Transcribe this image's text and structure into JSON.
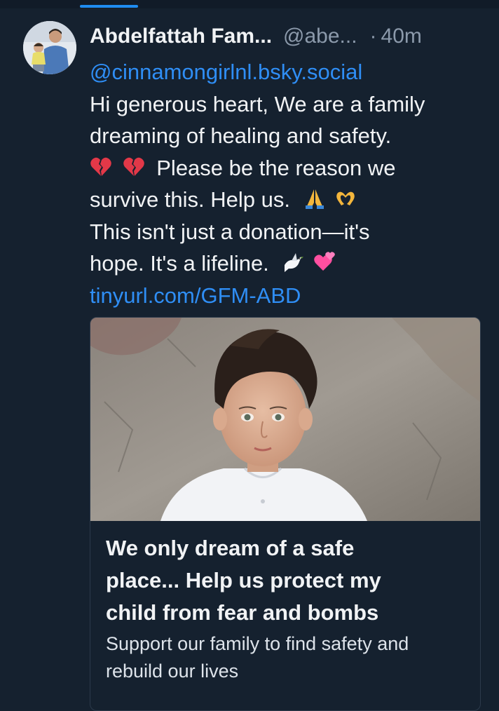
{
  "post": {
    "author_name": "Abdelfattah Fam...",
    "author_handle": "@abe...",
    "separator": "·",
    "timestamp": "40m",
    "mention": "@cinnamongirlnl.bsky.social",
    "text_line_1": "Hi generous heart, We are a family",
    "text_line_2": "dreaming of healing and safety.",
    "text_line_3": "Please be the reason we",
    "text_line_4": "survive this. Help us.",
    "text_line_5": "This isn't just a donation—it's",
    "text_line_6": "hope. It's a lifeline.",
    "link_text": "tinyurl.com/GFM-ABD",
    "emojis": [
      "broken-heart-icon",
      "broken-heart-icon",
      "folded-hands-icon",
      "heart-hands-icon",
      "dove-icon",
      "revolving-hearts-icon"
    ]
  },
  "link_card": {
    "title_line_1": "We only dream of a safe",
    "title_line_2": "place... Help us protect my",
    "title_line_3": "child from fear and bombs",
    "description_line_1": "Support our family to find safety and",
    "description_line_2": "rebuild our lives"
  },
  "colors": {
    "background": "#15212f",
    "text": "#f1f3f5",
    "muted": "#8c9aab",
    "link": "#2f8ef5",
    "accent": "#1f8cf0"
  }
}
